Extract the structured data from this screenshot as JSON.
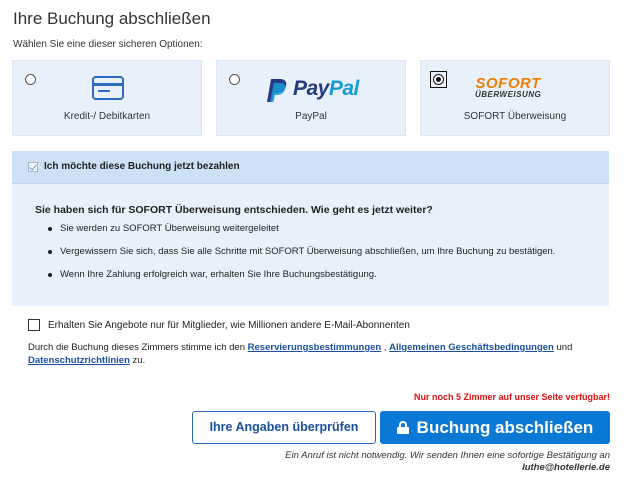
{
  "title": "Ihre Buchung abschließen",
  "subtitle": "Wählen Sie eine dieser sicheren Optionen:",
  "payment_options": [
    {
      "label": "Kredit-/ Debitkarten",
      "icon": "credit-card-icon",
      "selected": false
    },
    {
      "label": "PayPal",
      "icon": "paypal-logo",
      "logo_text_1": "Pay",
      "logo_text_2": "Pal",
      "selected": false
    },
    {
      "label": "SOFORT Überweisung",
      "icon": "sofort-logo",
      "logo_text_1": "SOFORT",
      "logo_text_2": "ÜBERWEISUNG",
      "selected": true
    }
  ],
  "pay_now": {
    "label": "Ich möchte diese Buchung jetzt bezahlen",
    "checked": true,
    "question": "Sie haben sich für SOFORT Überweisung entschieden. Wie geht es jetzt weiter?",
    "steps": [
      "Sie werden zu SOFORT Überweisung weitergeleitet",
      "Vergewissern Sie sich, dass Sie alle Schritte mit SOFORT Überweisung abschließen, um Ihre Buchung zu bestätigen.",
      "Wenn Ihre Zahlung erfolgreich war, erhalten Sie Ihre Buchungsbestätigung."
    ]
  },
  "member_offers": {
    "label": "Erhalten Sie Angebote nur für Mitglieder, wie Millionen andere E-Mail-Abonnenten",
    "checked": false
  },
  "terms": {
    "prefix": "Durch die Buchung dieses Zimmers stimme ich den ",
    "link1": "Reservierungsbestimmungen",
    "sep1": " , ",
    "link2": "Allgemeinen Geschäftsbedingungen",
    "sep2": " und ",
    "link3": "Datenschutzrichtlinien",
    "suffix": " zu."
  },
  "warning": "Nur noch 5 Zimmer auf unser Seite verfügbar!",
  "buttons": {
    "review": "Ihre Angaben überprüfen",
    "book": "Buchung abschließen"
  },
  "notice": {
    "line": "Ein Anruf ist nicht notwendig. Wir senden Ihnen eine sofortige Bestätigung an",
    "email": "luthe@hotellerie.de"
  },
  "colors": {
    "accent": "#0a79d6",
    "panel": "#e8f1fb",
    "panel_header": "#cde0f6",
    "warning": "#e0110e",
    "sofort_orange": "#ef7d00",
    "paypal_dark": "#253b80",
    "paypal_light": "#179bd7"
  }
}
